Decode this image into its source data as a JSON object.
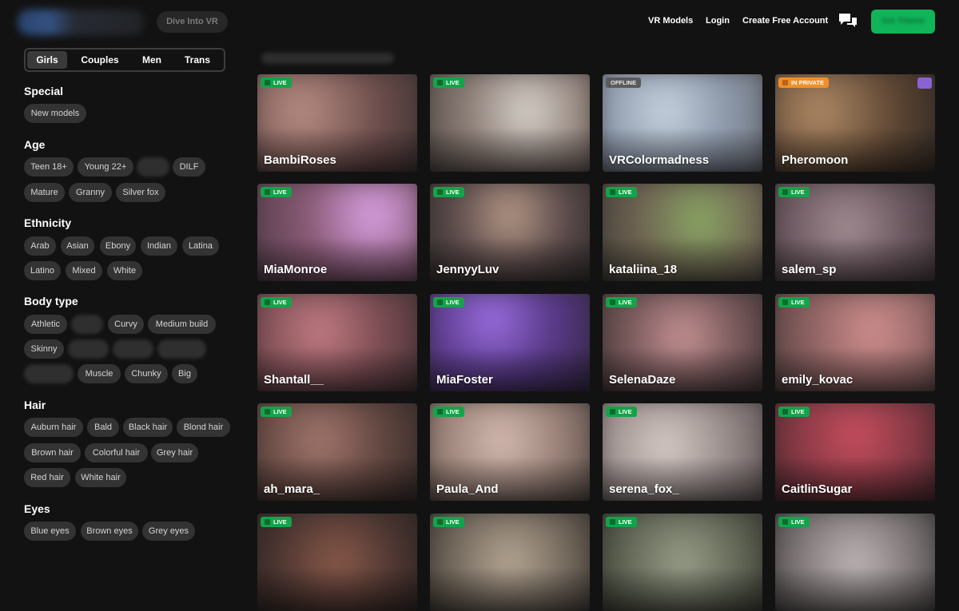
{
  "header": {
    "vr_button": "Dive Into VR",
    "nav": [
      "VR Models",
      "Login",
      "Create Free Account"
    ],
    "cta_label": "Get Tokens",
    "icons": {
      "chat": "chat-bubbles-icon"
    },
    "colors": {
      "cta": "#11b559",
      "background": "#121212"
    }
  },
  "sidebar": {
    "tabs": [
      "Girls",
      "Couples",
      "Men",
      "Trans"
    ],
    "active_tab": "Girls",
    "sections": [
      {
        "title": "Special",
        "chips": [
          "New models"
        ]
      },
      {
        "title": "Age",
        "chips": [
          "Teen 18+",
          "Young 22+",
          "",
          "DILF",
          "Mature",
          "Granny",
          "Silver fox"
        ]
      },
      {
        "title": "Ethnicity",
        "chips": [
          "Arab",
          "Asian",
          "Ebony",
          "Indian",
          "Latina",
          "Latino",
          "Mixed",
          "White"
        ]
      },
      {
        "title": "Body type",
        "chips": [
          "Athletic",
          "",
          "Curvy",
          "Medium build",
          "Skinny",
          "",
          "",
          "",
          "",
          "Muscle",
          "Chunky",
          "Big"
        ]
      },
      {
        "title": "Hair",
        "chips": [
          "Auburn hair",
          "Bald",
          "Black hair",
          "Blond hair",
          "Brown hair",
          "Colorful hair",
          "Grey hair",
          "Red hair",
          "White hair"
        ]
      },
      {
        "title": "Eyes",
        "chips": [
          "Blue eyes",
          "Brown eyes",
          "Grey eyes"
        ]
      }
    ]
  },
  "grid": {
    "title": "",
    "cards": [
      {
        "name": "BambiRoses",
        "status": "LIVE"
      },
      {
        "name": "",
        "status": "LIVE"
      },
      {
        "name": "VRColormadness",
        "status": "OFFLINE"
      },
      {
        "name": "Pheromoon",
        "status": "IN PRIVATE"
      },
      {
        "name": "MiaMonroe",
        "status": "LIVE"
      },
      {
        "name": "JennyyLuv",
        "status": "LIVE"
      },
      {
        "name": "kataliina_18",
        "status": "LIVE"
      },
      {
        "name": "salem_sp",
        "status": "LIVE"
      },
      {
        "name": "Shantall__",
        "status": "LIVE"
      },
      {
        "name": "MiaFoster",
        "status": "LIVE"
      },
      {
        "name": "SelenaDaze",
        "status": "LIVE"
      },
      {
        "name": "emily_kovac",
        "status": "LIVE"
      },
      {
        "name": "ah_mara_",
        "status": "LIVE"
      },
      {
        "name": "Paula_And",
        "status": "LIVE"
      },
      {
        "name": "serena_fox_",
        "status": "LIVE"
      },
      {
        "name": "CaitlinSugar",
        "status": "LIVE"
      },
      {
        "name": "",
        "status": "LIVE"
      },
      {
        "name": "",
        "status": "LIVE"
      },
      {
        "name": "",
        "status": "LIVE"
      },
      {
        "name": "",
        "status": "LIVE"
      }
    ]
  }
}
